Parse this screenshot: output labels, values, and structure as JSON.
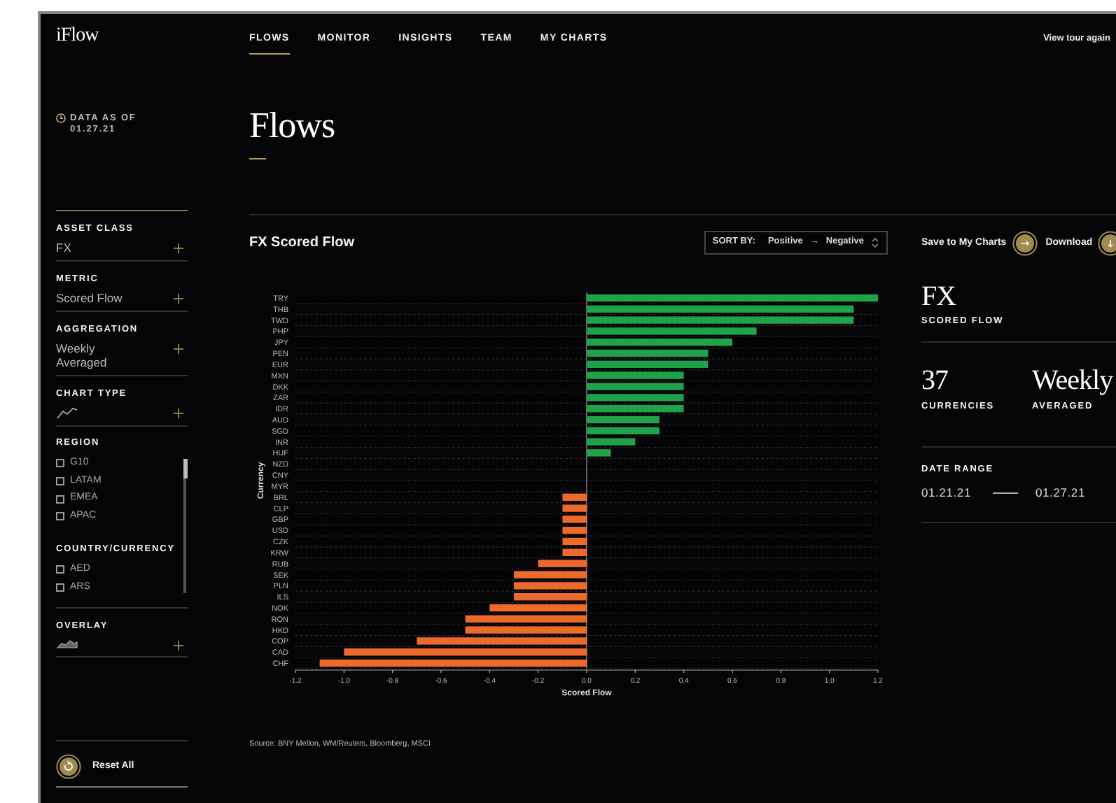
{
  "app": {
    "logo": "iFlow"
  },
  "nav": [
    {
      "label": "FLOWS",
      "selected": true
    },
    {
      "label": "MONITOR",
      "selected": false
    },
    {
      "label": "INSIGHTS",
      "selected": false
    },
    {
      "label": "TEAM",
      "selected": false
    },
    {
      "label": "MY CHARTS",
      "selected": false
    }
  ],
  "view_tour": "View tour again",
  "page_title": "Flows",
  "sidebar": {
    "data_as_of": {
      "label": "DATA AS OF",
      "date": "01.27.21"
    },
    "filters": [
      {
        "kind": "text",
        "label": "ASSET CLASS",
        "value": "FX"
      },
      {
        "kind": "text",
        "label": "METRIC",
        "value": "Scored Flow"
      },
      {
        "kind": "text",
        "label": "AGGREGATION",
        "value": "Weekly Averaged"
      },
      {
        "kind": "line-icon",
        "label": "CHART TYPE"
      }
    ],
    "checklists": [
      {
        "label": "REGION",
        "options": [
          {
            "label": "G10",
            "checked": false
          },
          {
            "label": "LATAM",
            "checked": false
          },
          {
            "label": "EMEA",
            "checked": false
          },
          {
            "label": "APAC",
            "checked": false
          }
        ]
      },
      {
        "label": "COUNTRY/CURRENCY",
        "options": [
          {
            "label": "AED",
            "checked": false
          },
          {
            "label": "ARS",
            "checked": false
          }
        ]
      }
    ],
    "overlay": {
      "kind": "area-icon",
      "label": "OVERLAY"
    },
    "reset": "Reset All"
  },
  "chart_panel": {
    "title": "FX Scored Flow",
    "sort": {
      "label": "SORT BY:",
      "from": "Positive",
      "arrow": "→",
      "to": "Negative"
    },
    "chart_data": {
      "type": "bar",
      "orientation": "horizontal",
      "xlabel": "Scored Flow",
      "ylabel": "Currency",
      "categories": [
        "TRY",
        "THB",
        "TWD",
        "PHP",
        "JPY",
        "PEN",
        "EUR",
        "MXN",
        "DKK",
        "ZAR",
        "IDR",
        "AUD",
        "SGD",
        "INR",
        "HUF",
        "NZD",
        "CNY",
        "MYR",
        "BRL",
        "CLP",
        "GBP",
        "USD",
        "CZK",
        "KRW",
        "RUB",
        "SEK",
        "PLN",
        "ILS",
        "NOK",
        "RON",
        "HKD",
        "COP",
        "CAD",
        "CHF"
      ],
      "values": [
        1.2,
        1.1,
        1.1,
        0.7,
        0.6,
        0.5,
        0.5,
        0.4,
        0.4,
        0.4,
        0.4,
        0.3,
        0.3,
        0.2,
        0.1,
        0,
        0,
        0,
        -0.1,
        -0.1,
        -0.1,
        -0.1,
        -0.1,
        -0.1,
        -0.2,
        -0.3,
        -0.3,
        -0.3,
        -0.4,
        -0.5,
        -0.5,
        -0.7,
        -1.0,
        -1.1
      ],
      "xlim": [
        -1.2,
        1.2
      ],
      "xticks": [
        {
          "value": -1.2,
          "label": "-1.2"
        },
        {
          "value": -1,
          "label": "-1.0"
        },
        {
          "value": -0.8,
          "label": "-0.8"
        },
        {
          "value": -0.6,
          "label": "-0.6"
        },
        {
          "value": -0.4,
          "label": "-0.4"
        },
        {
          "value": -0.2,
          "label": "-0.2"
        },
        {
          "value": 0,
          "label": "0.0"
        },
        {
          "value": 0.2,
          "label": "0.2"
        },
        {
          "value": 0.4,
          "label": "0.4"
        },
        {
          "value": 0.6,
          "label": "0.6"
        },
        {
          "value": 0.8,
          "label": "0.8"
        },
        {
          "value": 1,
          "label": "1.0"
        },
        {
          "value": 1.2,
          "label": "1.2"
        }
      ]
    },
    "source": "Source:  BNY Mellon, WM/Reuters, Bloomberg, MSCI"
  },
  "actions": [
    {
      "label": "Save to My Charts"
    },
    {
      "label": "Download"
    }
  ],
  "summary": {
    "asset": "FX",
    "metric": "SCORED FLOW",
    "stats": [
      {
        "value": "37",
        "label": "CURRENCIES"
      },
      {
        "value": "Weekly",
        "label": "AVERAGED"
      }
    ],
    "date_range": {
      "label": "DATE RANGE",
      "start": "01.21.21",
      "end": "01.27.21"
    }
  }
}
